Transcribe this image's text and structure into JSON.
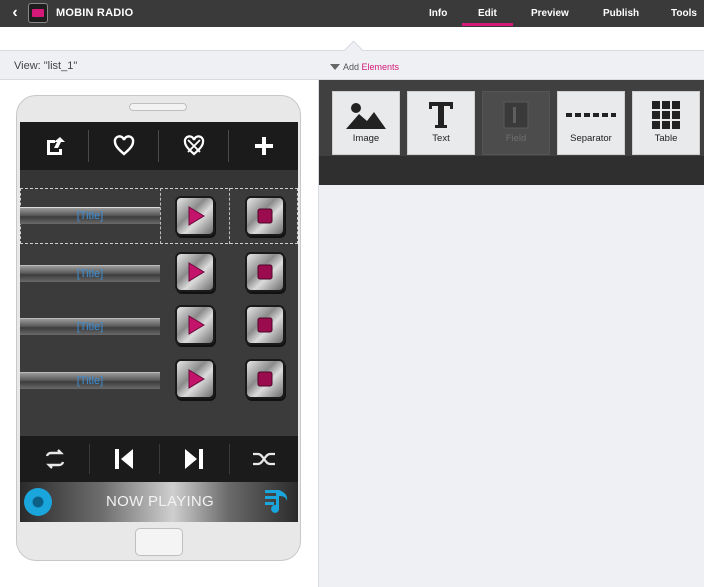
{
  "topbar": {
    "app_title": "MOBIN RADIO",
    "nav": [
      {
        "label": "Info",
        "active": false
      },
      {
        "label": "Edit",
        "active": true
      },
      {
        "label": "Preview",
        "active": false
      },
      {
        "label": "Publish",
        "active": false
      },
      {
        "label": "Tools",
        "active": false
      }
    ]
  },
  "view_label": "View: \"list_1\"",
  "add_elements": {
    "prefix": "Add",
    "highlight": "Elements"
  },
  "palette": [
    {
      "label": "Image",
      "icon": "image-icon",
      "enabled": true
    },
    {
      "label": "Text",
      "icon": "text-icon",
      "enabled": true
    },
    {
      "label": "Field",
      "icon": "field-icon",
      "enabled": false
    },
    {
      "label": "Separator",
      "icon": "separator-icon",
      "enabled": true
    },
    {
      "label": "Table",
      "icon": "table-icon",
      "enabled": true
    }
  ],
  "phone": {
    "top_icons": [
      "share-icon",
      "heart-icon",
      "heart-off-icon",
      "plus-icon"
    ],
    "list_rows": [
      {
        "title": "[Title]",
        "selected": true
      },
      {
        "title": "[Title]",
        "selected": false
      },
      {
        "title": "[Title]",
        "selected": false
      },
      {
        "title": "[Title]",
        "selected": false
      }
    ],
    "controls": [
      "repeat-icon",
      "previous-icon",
      "next-icon",
      "shuffle-icon"
    ],
    "now_playing": "NOW PLAYING"
  },
  "colors": {
    "accent": "#d4197a",
    "title_link": "#3d8fd6",
    "np_disc": "#1aa6dc"
  }
}
